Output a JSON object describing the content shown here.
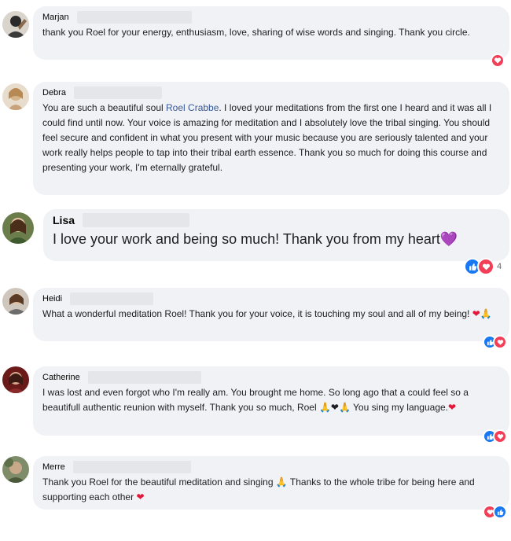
{
  "comments": [
    {
      "author": "Marjan",
      "text": "thank you Roel for your energy, enthusiasm, love, sharing of wise words and singing. Thank you circle.",
      "reactions": [
        "love"
      ],
      "count": ""
    },
    {
      "author": "Debra",
      "text_before": "You are such a beautiful soul ",
      "mention": "Roel Crabbe",
      "text": ". I loved your meditations from the first one I heard and it was all I could find until now. Your voice is amazing for meditation and I absolutely love the tribal singing. You should feel secure and confident in what you present with your music because you are seriously talented and your work really helps people to tap into their tribal earth essence. Thank you so much for doing this course and presenting your work, I'm eternally grateful.",
      "reactions": [],
      "count": ""
    },
    {
      "author": "Lisa",
      "text": "I love your work and being so much! Thank you from my heart",
      "emoji": "💜",
      "reactions": [
        "like",
        "love"
      ],
      "count": "4"
    },
    {
      "author": "Heidi",
      "text": "What a wonderful meditation Roel! Thank you for your voice, it is touching my soul and all of my being!",
      "emoji": "❤🙏",
      "reactions": [
        "like",
        "love"
      ],
      "count": ""
    },
    {
      "author": "Catherine",
      "text": "I was lost and even forgot who I'm really am. You brought me home. So long ago that a could feel so a beautifull authentic reunion with myself. Thank you so much, Roel 🙏❤🙏 You sing my language.",
      "emoji": "❤",
      "reactions": [
        "like",
        "love"
      ],
      "count": ""
    },
    {
      "author": "Merre",
      "text": "Thank you Roel for the beautiful meditation and singing 🙏 Thanks to the whole tribe for being here and supporting each other",
      "emoji": "❤",
      "reactions": [
        "love",
        "like"
      ],
      "count": ""
    }
  ],
  "colors": {
    "bubble": "#f0f2f5",
    "like": "#1877f2",
    "love": "#f33e58",
    "mention": "#385898"
  },
  "icons": {
    "like": "thumbs-up-icon",
    "love": "heart-icon"
  }
}
